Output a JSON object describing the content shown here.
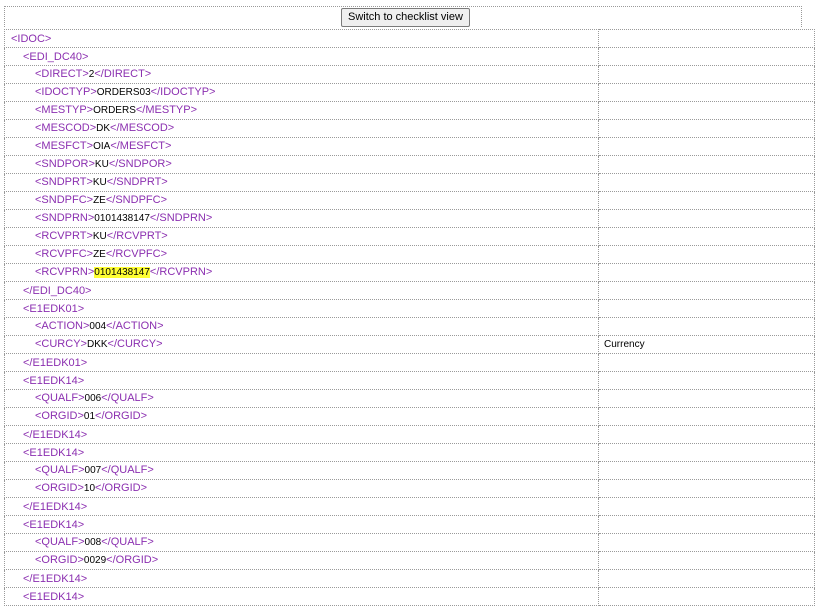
{
  "toolbar": {
    "switch_label": "Switch to checklist view"
  },
  "rows": [
    {
      "depth": 0,
      "open": "<IDOC>",
      "value": "",
      "close": "",
      "note": ""
    },
    {
      "depth": 1,
      "open": "<EDI_DC40>",
      "value": "",
      "close": "",
      "note": ""
    },
    {
      "depth": 2,
      "open": "<DIRECT>",
      "value": "2",
      "close": "</DIRECT>",
      "note": ""
    },
    {
      "depth": 2,
      "open": "<IDOCTYP>",
      "value": "ORDERS03",
      "close": "</IDOCTYP>",
      "note": ""
    },
    {
      "depth": 2,
      "open": "<MESTYP>",
      "value": "ORDERS",
      "close": "</MESTYP>",
      "note": ""
    },
    {
      "depth": 2,
      "open": "<MESCOD>",
      "value": "DK",
      "close": "</MESCOD>",
      "note": ""
    },
    {
      "depth": 2,
      "open": "<MESFCT>",
      "value": "OIA",
      "close": "</MESFCT>",
      "note": ""
    },
    {
      "depth": 2,
      "open": "<SNDPOR>",
      "value": "KU",
      "close": "</SNDPOR>",
      "note": ""
    },
    {
      "depth": 2,
      "open": "<SNDPRT>",
      "value": "KU",
      "close": "</SNDPRT>",
      "note": ""
    },
    {
      "depth": 2,
      "open": "<SNDPFC>",
      "value": "ZE",
      "close": "</SNDPFC>",
      "note": ""
    },
    {
      "depth": 2,
      "open": "<SNDPRN>",
      "value": "0101438147",
      "close": "</SNDPRN>",
      "note": ""
    },
    {
      "depth": 2,
      "open": "<RCVPRT>",
      "value": "KU",
      "close": "</RCVPRT>",
      "note": ""
    },
    {
      "depth": 2,
      "open": "<RCVPFC>",
      "value": "ZE",
      "close": "</RCVPFC>",
      "note": ""
    },
    {
      "depth": 2,
      "open": "<RCVPRN>",
      "value": "0101438147",
      "close": "</RCVPRN>",
      "note": "",
      "highlight": true
    },
    {
      "depth": 1,
      "open": "</EDI_DC40>",
      "value": "",
      "close": "",
      "note": ""
    },
    {
      "depth": 1,
      "open": "<E1EDK01>",
      "value": "",
      "close": "",
      "note": ""
    },
    {
      "depth": 2,
      "open": "<ACTION>",
      "value": "004",
      "close": "</ACTION>",
      "note": ""
    },
    {
      "depth": 2,
      "open": "<CURCY>",
      "value": "DKK",
      "close": "</CURCY>",
      "note": "Currency"
    },
    {
      "depth": 1,
      "open": "</E1EDK01>",
      "value": "",
      "close": "",
      "note": ""
    },
    {
      "depth": 1,
      "open": "<E1EDK14>",
      "value": "",
      "close": "",
      "note": ""
    },
    {
      "depth": 2,
      "open": "<QUALF>",
      "value": "006",
      "close": "</QUALF>",
      "note": ""
    },
    {
      "depth": 2,
      "open": "<ORGID>",
      "value": "01",
      "close": "</ORGID>",
      "note": ""
    },
    {
      "depth": 1,
      "open": "</E1EDK14>",
      "value": "",
      "close": "",
      "note": ""
    },
    {
      "depth": 1,
      "open": "<E1EDK14>",
      "value": "",
      "close": "",
      "note": ""
    },
    {
      "depth": 2,
      "open": "<QUALF>",
      "value": "007",
      "close": "</QUALF>",
      "note": ""
    },
    {
      "depth": 2,
      "open": "<ORGID>",
      "value": "10",
      "close": "</ORGID>",
      "note": ""
    },
    {
      "depth": 1,
      "open": "</E1EDK14>",
      "value": "",
      "close": "",
      "note": ""
    },
    {
      "depth": 1,
      "open": "<E1EDK14>",
      "value": "",
      "close": "",
      "note": ""
    },
    {
      "depth": 2,
      "open": "<QUALF>",
      "value": "008",
      "close": "</QUALF>",
      "note": ""
    },
    {
      "depth": 2,
      "open": "<ORGID>",
      "value": "0029",
      "close": "</ORGID>",
      "note": ""
    },
    {
      "depth": 1,
      "open": "</E1EDK14>",
      "value": "",
      "close": "",
      "note": ""
    },
    {
      "depth": 1,
      "open": "<E1EDK14>",
      "value": "",
      "close": "",
      "note": ""
    }
  ]
}
